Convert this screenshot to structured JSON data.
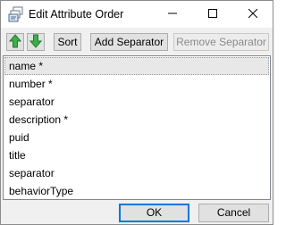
{
  "window": {
    "title": "Edit Attribute Order",
    "app_icon": "stacked-forms-icon",
    "controls": [
      "minimize-icon",
      "maximize-icon",
      "close-icon"
    ]
  },
  "toolbar": {
    "move_up_icon": "green-up-arrow-icon",
    "move_down_icon": "green-down-arrow-icon",
    "sort_label": "Sort",
    "add_separator_label": "Add Separator",
    "remove_separator_label": "Remove Separator",
    "remove_separator_enabled": false
  },
  "attributes": {
    "items": [
      "name *",
      "number *",
      "separator",
      "description *",
      "puid",
      "title",
      "separator",
      "behaviorType"
    ],
    "selected": "name *"
  },
  "footer": {
    "ok_label": "OK",
    "cancel_label": "Cancel"
  },
  "colors": {
    "arrow_green": "#3fae49",
    "focus_blue": "#0078d7",
    "selection_gray": "#e8e8e8"
  }
}
